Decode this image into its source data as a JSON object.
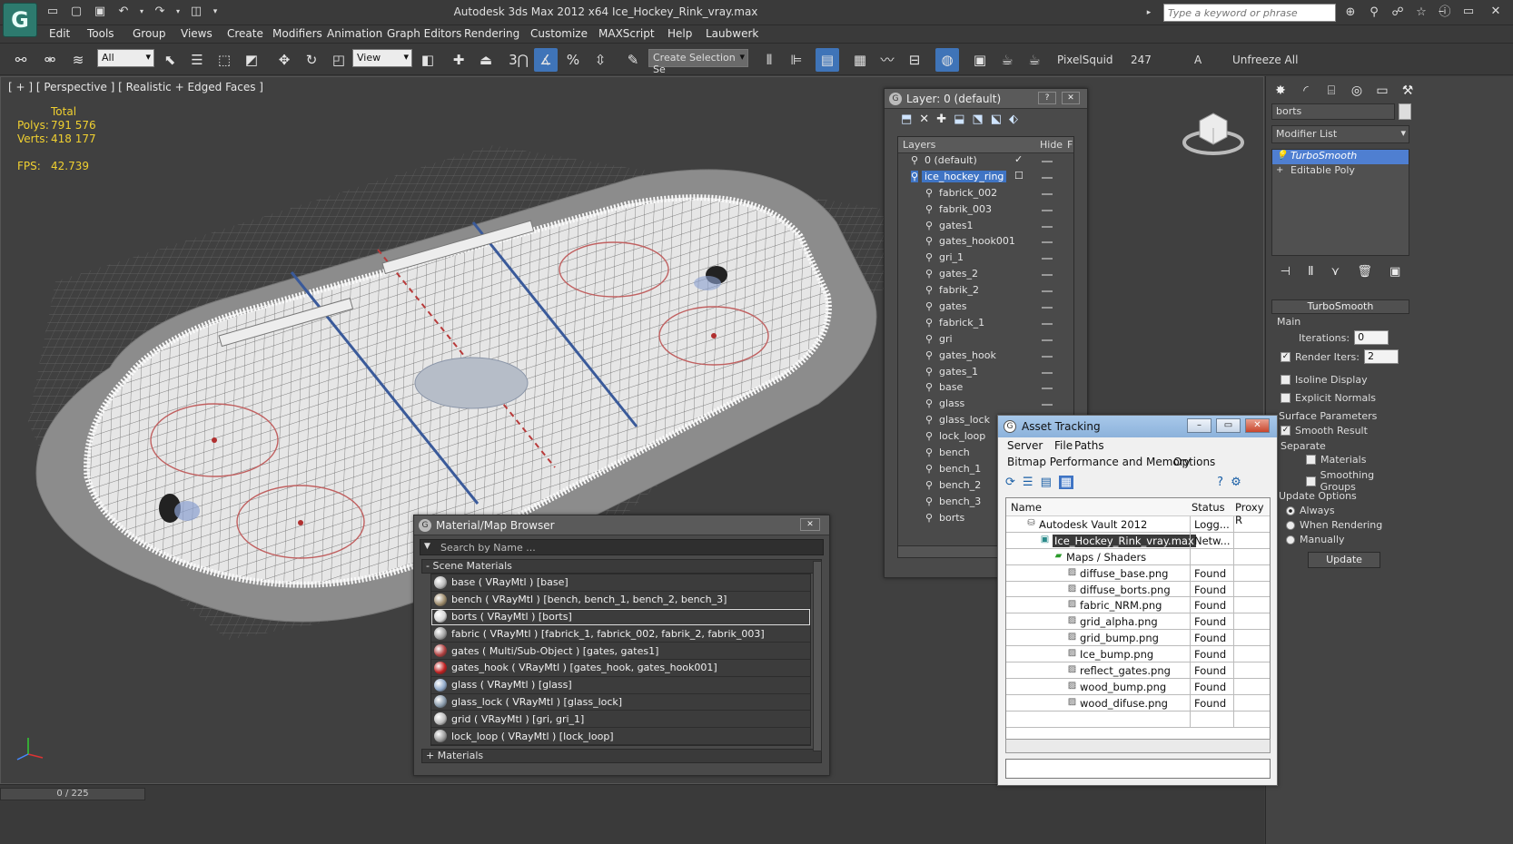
{
  "app": {
    "title": "Autodesk 3ds Max  2012 x64     Ice_Hockey_Rink_vray.max",
    "logo": "3ds-max-logo",
    "search_placeholder": "Type a keyword or phrase"
  },
  "menu": [
    "Edit",
    "Tools",
    "Group",
    "Views",
    "Create",
    "Modifiers",
    "Animation",
    "Graph Editors",
    "Rendering",
    "Customize",
    "MAXScript",
    "Help",
    "Laubwerk"
  ],
  "toolbar": {
    "filter_combo": "All",
    "view_combo": "View",
    "selection_set_combo": "Create Selection Se",
    "snap_number": "3",
    "pixelsquid": "PixelSquid",
    "count": "247",
    "a_label": "A",
    "unfreeze": "Unfreeze All"
  },
  "viewport": {
    "label": "[ + ] [ Perspective ] [ Realistic + Edged Faces ]",
    "total_label": "Total",
    "polys_label": "Polys:",
    "polys_value": "791 576",
    "verts_label": "Verts:",
    "verts_value": "418 177",
    "fps_label": "FPS:",
    "fps_value": "42.739"
  },
  "status": {
    "frame": "0 / 225"
  },
  "command_panel": {
    "object_name": "borts",
    "modifier_list": "Modifier List",
    "stack": [
      {
        "label": "TurboSmooth",
        "selected": true
      },
      {
        "label": "Editable Poly",
        "selected": false
      }
    ],
    "rollout_title": "TurboSmooth",
    "main_group": "Main",
    "iterations_label": "Iterations:",
    "iterations_value": "0",
    "render_iters_label": "Render Iters:",
    "render_iters_value": "2",
    "isoline_label": "Isoline Display",
    "explicit_normals_label": "Explicit Normals",
    "surface_params_group": "Surface Parameters",
    "smooth_result_label": "Smooth Result",
    "separate_label": "Separate",
    "materials_label": "Materials",
    "smoothing_groups_label": "Smoothing Groups",
    "update_options_group": "Update Options",
    "always_label": "Always",
    "when_rendering_label": "When Rendering",
    "manually_label": "Manually",
    "update_button": "Update"
  },
  "layer_window": {
    "title": "Layer: 0 (default)",
    "col_layers": "Layers",
    "col_hide": "Hide",
    "col_f": "F",
    "layers": [
      {
        "name": "0 (default)",
        "level": 0,
        "selected": false
      },
      {
        "name": "ice_hockey_ring",
        "level": 0,
        "selected": true
      },
      {
        "name": "fabrick_002",
        "level": 1,
        "selected": false
      },
      {
        "name": "fabrik_003",
        "level": 1,
        "selected": false
      },
      {
        "name": "gates1",
        "level": 1,
        "selected": false
      },
      {
        "name": "gates_hook001",
        "level": 1,
        "selected": false
      },
      {
        "name": "gri_1",
        "level": 1,
        "selected": false
      },
      {
        "name": "gates_2",
        "level": 1,
        "selected": false
      },
      {
        "name": "fabrik_2",
        "level": 1,
        "selected": false
      },
      {
        "name": "gates",
        "level": 1,
        "selected": false
      },
      {
        "name": "fabrick_1",
        "level": 1,
        "selected": false
      },
      {
        "name": "gri",
        "level": 1,
        "selected": false
      },
      {
        "name": "gates_hook",
        "level": 1,
        "selected": false
      },
      {
        "name": "gates_1",
        "level": 1,
        "selected": false
      },
      {
        "name": "base",
        "level": 1,
        "selected": false
      },
      {
        "name": "glass",
        "level": 1,
        "selected": false
      },
      {
        "name": "glass_lock",
        "level": 1,
        "selected": false
      },
      {
        "name": "lock_loop",
        "level": 1,
        "selected": false
      },
      {
        "name": "bench",
        "level": 1,
        "selected": false
      },
      {
        "name": "bench_1",
        "level": 1,
        "selected": false
      },
      {
        "name": "bench_2",
        "level": 1,
        "selected": false
      },
      {
        "name": "bench_3",
        "level": 1,
        "selected": false
      },
      {
        "name": "borts",
        "level": 1,
        "selected": false
      }
    ]
  },
  "material_browser": {
    "title": "Material/Map Browser",
    "search_placeholder": "Search by Name ...",
    "scene_section": "- Scene Materials",
    "materials_section": "+ Materials",
    "items": [
      {
        "label": "base  ( VRayMtl ) [base]",
        "color": "#b8b8b8",
        "selected": false
      },
      {
        "label": "bench  ( VRayMtl ) [bench, bench_1, bench_2, bench_3]",
        "color": "#9c8a6a",
        "selected": false
      },
      {
        "label": "borts  ( VRayMtl ) [borts]",
        "color": "#d8d8d8",
        "selected": true
      },
      {
        "label": "fabric  ( VRayMtl ) [fabrick_1, fabrick_002, fabrik_2, fabrik_003]",
        "color": "#a0a0a0",
        "selected": false
      },
      {
        "label": "gates  ( Multi/Sub-Object ) [gates, gates1]",
        "color": "#b04040",
        "selected": false
      },
      {
        "label": "gates_hook  ( VRayMtl ) [gates_hook, gates_hook001]",
        "color": "#c02020",
        "selected": false
      },
      {
        "label": "glass  ( VRayMtl ) [glass]",
        "color": "#8fa8c8",
        "selected": false
      },
      {
        "label": "glass_lock  ( VRayMtl ) [glass_lock]",
        "color": "#8899aa",
        "selected": false
      },
      {
        "label": "grid  ( VRayMtl ) [gri, gri_1]",
        "color": "#bcbcbc",
        "selected": false
      },
      {
        "label": "lock_loop  ( VRayMtl ) [lock_loop]",
        "color": "#999999",
        "selected": false
      }
    ]
  },
  "asset_window": {
    "title": "Asset Tracking",
    "menu": [
      "Server",
      "File",
      "Paths"
    ],
    "menu2": [
      "Bitmap Performance and Memory",
      "Options"
    ],
    "col_name": "Name",
    "col_status": "Status",
    "col_proxy": "Proxy R",
    "rows": [
      {
        "name": "Autodesk Vault 2012",
        "status": "Logg...",
        "level": 0,
        "icon": "vault-icon"
      },
      {
        "name": "Ice_Hockey_Rink_vray.max",
        "status": "Netw...",
        "level": 1,
        "icon": "max-file-icon"
      },
      {
        "name": "Maps / Shaders",
        "status": "",
        "level": 2,
        "icon": "maps-folder-icon"
      },
      {
        "name": "diffuse_base.png",
        "status": "Found",
        "level": 3,
        "icon": "bitmap-icon"
      },
      {
        "name": "diffuse_borts.png",
        "status": "Found",
        "level": 3,
        "icon": "bitmap-icon"
      },
      {
        "name": "fabric_NRM.png",
        "status": "Found",
        "level": 3,
        "icon": "bitmap-icon"
      },
      {
        "name": "grid_alpha.png",
        "status": "Found",
        "level": 3,
        "icon": "bitmap-icon"
      },
      {
        "name": "grid_bump.png",
        "status": "Found",
        "level": 3,
        "icon": "bitmap-icon"
      },
      {
        "name": "Ice_bump.png",
        "status": "Found",
        "level": 3,
        "icon": "bitmap-icon"
      },
      {
        "name": "reflect_gates.png",
        "status": "Found",
        "level": 3,
        "icon": "bitmap-icon"
      },
      {
        "name": "wood_bump.png",
        "status": "Found",
        "level": 3,
        "icon": "bitmap-icon"
      },
      {
        "name": "wood_difuse.png",
        "status": "Found",
        "level": 3,
        "icon": "bitmap-icon"
      },
      {
        "name": "",
        "status": "",
        "level": 0,
        "icon": ""
      }
    ]
  },
  "colors": {
    "accent_blue": "#3f74c4",
    "stat_yellow": "#f0d030",
    "viewport_bg": "#404040"
  }
}
